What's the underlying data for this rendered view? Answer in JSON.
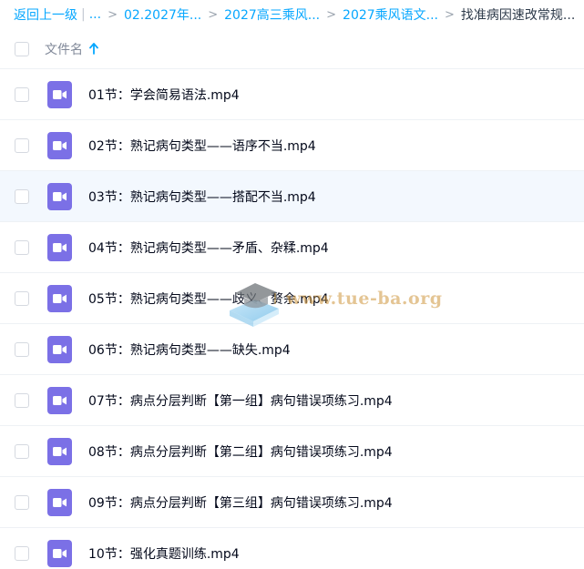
{
  "breadcrumb": {
    "back_label": "返回上一级",
    "ellipsis": "...",
    "items": [
      "02.2027年...",
      "2027高三乘风...",
      "2027乘风语文..."
    ],
    "current": "找准病因速改常规..."
  },
  "list": {
    "header_label": "文件名",
    "sort_icon": "arrow-up-icon",
    "file_icon": "video-file-icon",
    "files": [
      {
        "name": "01节：学会简易语法.mp4"
      },
      {
        "name": "02节：熟记病句类型——语序不当.mp4"
      },
      {
        "name": "03节：熟记病句类型——搭配不当.mp4"
      },
      {
        "name": "04节：熟记病句类型——矛盾、杂糅.mp4"
      },
      {
        "name": "05节：熟记病句类型——歧义、赘余.mp4"
      },
      {
        "name": "06节：熟记病句类型——缺失.mp4"
      },
      {
        "name": "07节：病点分层判断【第一组】病句错误项练习.mp4"
      },
      {
        "name": "08节：病点分层判断【第二组】病句错误项练习.mp4"
      },
      {
        "name": "09节：病点分层判断【第三组】病句错误项练习.mp4"
      },
      {
        "name": "10节：强化真题训练.mp4"
      }
    ]
  },
  "watermark": {
    "text": "www.tue-ba.org"
  },
  "colors": {
    "accent": "#06a7ff",
    "video_icon": "#7b70e6",
    "hover_row": "#f3f8fe"
  }
}
